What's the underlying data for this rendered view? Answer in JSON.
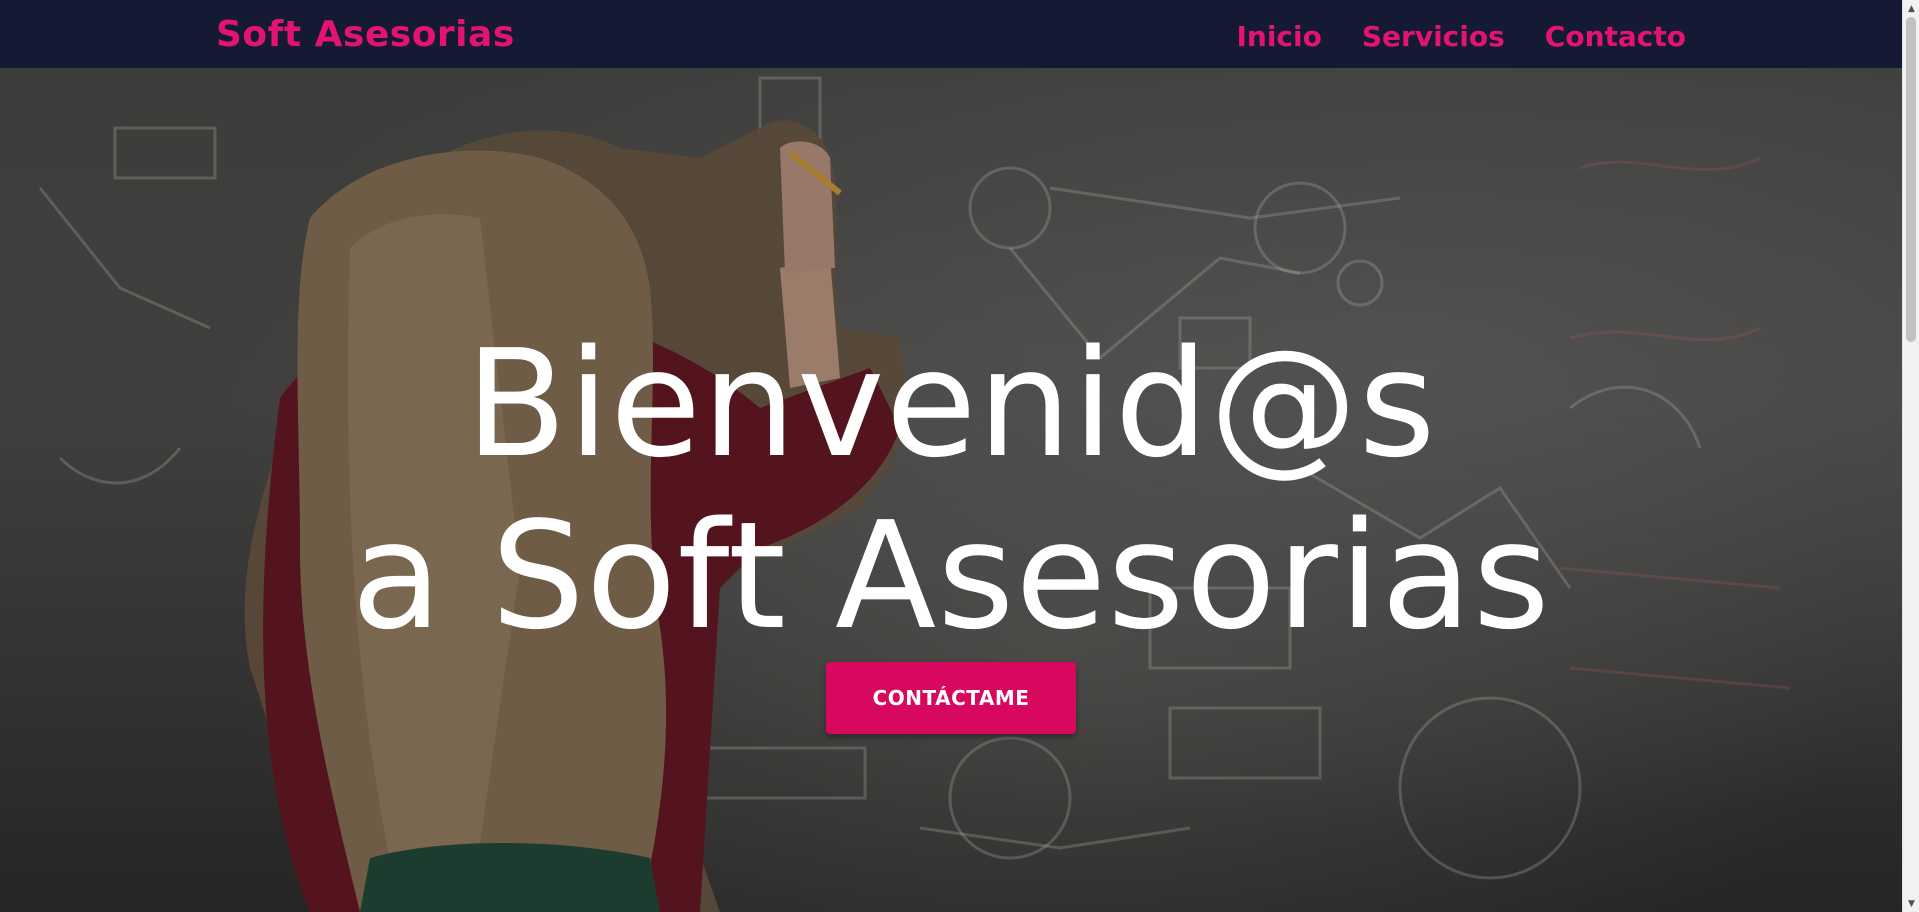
{
  "navbar": {
    "brand": "Soft Asesorias",
    "links": [
      {
        "label": "Inicio"
      },
      {
        "label": "Servicios"
      },
      {
        "label": "Contacto"
      }
    ]
  },
  "hero": {
    "title_line1": "Bienvenid@s",
    "title_line2": "a Soft Asesorias",
    "cta_label": "CONTÁCTAME",
    "background_image": "woman-writing-on-chalkboard-photo"
  },
  "colors": {
    "accent": "#e3146f",
    "button": "#d8085f",
    "navbar_bg": "#141a33",
    "text_light": "#ffffff"
  },
  "scrollbar": {
    "up_icon": "triangle-up-icon",
    "down_icon": "triangle-down-icon"
  }
}
